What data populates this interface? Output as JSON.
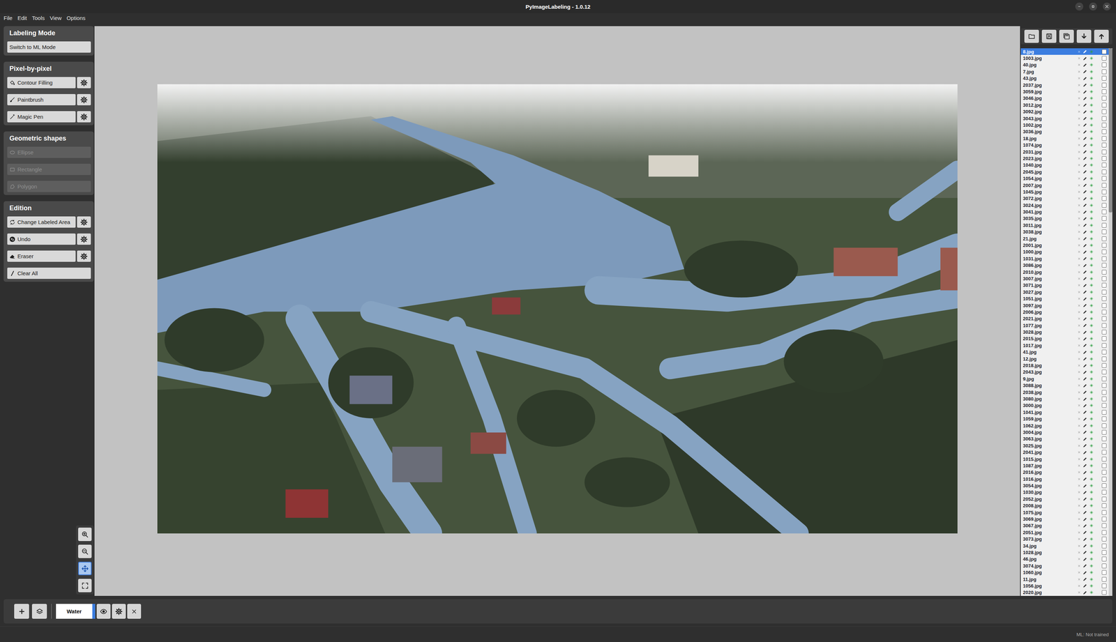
{
  "window": {
    "title": "PyImageLabeling - 1.0.12"
  },
  "menu": [
    "File",
    "Edit",
    "Tools",
    "View",
    "Options"
  ],
  "tool_groups": [
    {
      "title": "Labeling Mode",
      "tools": [
        {
          "label": "Switch to ML Mode",
          "disabled": false,
          "settings": false
        }
      ]
    },
    {
      "title": "Pixel-by-pixel",
      "tools": [
        {
          "label": "Contour Filling",
          "disabled": false,
          "settings": true
        },
        {
          "label": "Paintbrush",
          "disabled": false,
          "settings": true
        },
        {
          "label": "Magic Pen",
          "disabled": false,
          "settings": true
        }
      ]
    },
    {
      "title": "Geometric shapes",
      "tools": [
        {
          "label": "Ellipse",
          "disabled": true,
          "settings": false
        },
        {
          "label": "Rectangle",
          "disabled": true,
          "settings": false
        },
        {
          "label": "Polygon",
          "disabled": true,
          "settings": false
        }
      ]
    },
    {
      "title": "Edition",
      "tools": [
        {
          "label": "Change Labeled Area",
          "disabled": false,
          "settings": true
        },
        {
          "label": "Undo",
          "disabled": false,
          "settings": true
        },
        {
          "label": "Eraser",
          "disabled": false,
          "settings": true
        },
        {
          "label": "Clear All",
          "disabled": false,
          "settings": false
        }
      ]
    }
  ],
  "view_tools": [
    {
      "selected": false
    },
    {
      "selected": false
    },
    {
      "selected": true
    },
    {
      "selected": false
    }
  ],
  "file_list": {
    "scroll": {
      "level": 0.3
    },
    "files": [
      {
        "name": "8.jpg",
        "selected": true,
        "checked": false
      },
      {
        "name": "1003.jpg",
        "selected": false,
        "checked": false
      },
      {
        "name": "40.jpg",
        "selected": false,
        "checked": false
      },
      {
        "name": "7.jpg",
        "selected": false,
        "checked": false
      },
      {
        "name": "43.jpg",
        "selected": false,
        "checked": false
      },
      {
        "name": "2037.jpg",
        "selected": false,
        "checked": false
      },
      {
        "name": "3059.jpg",
        "selected": false,
        "checked": false
      },
      {
        "name": "3046.jpg",
        "selected": false,
        "checked": false
      },
      {
        "name": "3012.jpg",
        "selected": false,
        "checked": false
      },
      {
        "name": "3092.jpg",
        "selected": false,
        "checked": false
      },
      {
        "name": "3043.jpg",
        "selected": false,
        "checked": false
      },
      {
        "name": "1002.jpg",
        "selected": false,
        "checked": false
      },
      {
        "name": "3036.jpg",
        "selected": false,
        "checked": false
      },
      {
        "name": "18.jpg",
        "selected": false,
        "checked": false
      },
      {
        "name": "1074.jpg",
        "selected": false,
        "checked": false
      },
      {
        "name": "2031.jpg",
        "selected": false,
        "checked": false
      },
      {
        "name": "2023.jpg",
        "selected": false,
        "checked": false
      },
      {
        "name": "1040.jpg",
        "selected": false,
        "checked": false
      },
      {
        "name": "2045.jpg",
        "selected": false,
        "checked": false
      },
      {
        "name": "1054.jpg",
        "selected": false,
        "checked": false
      },
      {
        "name": "2007.jpg",
        "selected": false,
        "checked": false
      },
      {
        "name": "1045.jpg",
        "selected": false,
        "checked": false
      },
      {
        "name": "3072.jpg",
        "selected": false,
        "checked": false
      },
      {
        "name": "3024.jpg",
        "selected": false,
        "checked": false
      },
      {
        "name": "3041.jpg",
        "selected": false,
        "checked": false
      },
      {
        "name": "3035.jpg",
        "selected": false,
        "checked": false
      },
      {
        "name": "3011.jpg",
        "selected": false,
        "checked": false
      },
      {
        "name": "3038.jpg",
        "selected": false,
        "checked": false
      },
      {
        "name": "21.jpg",
        "selected": false,
        "checked": false
      },
      {
        "name": "2001.jpg",
        "selected": false,
        "checked": false
      },
      {
        "name": "1000.jpg",
        "selected": false,
        "checked": false
      },
      {
        "name": "1031.jpg",
        "selected": false,
        "checked": false
      },
      {
        "name": "3086.jpg",
        "selected": false,
        "checked": false
      },
      {
        "name": "2010.jpg",
        "selected": false,
        "checked": false
      },
      {
        "name": "3007.jpg",
        "selected": false,
        "checked": false
      },
      {
        "name": "3071.jpg",
        "selected": false,
        "checked": false
      },
      {
        "name": "3027.jpg",
        "selected": false,
        "checked": false
      },
      {
        "name": "1051.jpg",
        "selected": false,
        "checked": false
      },
      {
        "name": "3097.jpg",
        "selected": false,
        "checked": false
      },
      {
        "name": "2006.jpg",
        "selected": false,
        "checked": false
      },
      {
        "name": "2021.jpg",
        "selected": false,
        "checked": false
      },
      {
        "name": "1077.jpg",
        "selected": false,
        "checked": false
      },
      {
        "name": "3028.jpg",
        "selected": false,
        "checked": false
      },
      {
        "name": "2015.jpg",
        "selected": false,
        "checked": false
      },
      {
        "name": "1017.jpg",
        "selected": false,
        "checked": false
      },
      {
        "name": "41.jpg",
        "selected": false,
        "checked": false
      },
      {
        "name": "12.jpg",
        "selected": false,
        "checked": false
      },
      {
        "name": "2018.jpg",
        "selected": false,
        "checked": false
      },
      {
        "name": "2043.jpg",
        "selected": false,
        "checked": false
      },
      {
        "name": "9.jpg",
        "selected": false,
        "checked": false
      },
      {
        "name": "3088.jpg",
        "selected": false,
        "checked": false
      },
      {
        "name": "2038.jpg",
        "selected": false,
        "checked": false
      },
      {
        "name": "3080.jpg",
        "selected": false,
        "checked": false
      },
      {
        "name": "3000.jpg",
        "selected": false,
        "checked": false
      },
      {
        "name": "1041.jpg",
        "selected": false,
        "checked": false
      },
      {
        "name": "1059.jpg",
        "selected": false,
        "checked": false
      },
      {
        "name": "1062.jpg",
        "selected": false,
        "checked": false
      },
      {
        "name": "3004.jpg",
        "selected": false,
        "checked": false
      },
      {
        "name": "3063.jpg",
        "selected": false,
        "checked": false
      },
      {
        "name": "3025.jpg",
        "selected": false,
        "checked": false
      },
      {
        "name": "2041.jpg",
        "selected": false,
        "checked": false
      },
      {
        "name": "1015.jpg",
        "selected": false,
        "checked": false
      },
      {
        "name": "1087.jpg",
        "selected": false,
        "checked": false
      },
      {
        "name": "2016.jpg",
        "selected": false,
        "checked": false
      },
      {
        "name": "1016.jpg",
        "selected": false,
        "checked": false
      },
      {
        "name": "3054.jpg",
        "selected": false,
        "checked": false
      },
      {
        "name": "1030.jpg",
        "selected": false,
        "checked": false
      },
      {
        "name": "2052.jpg",
        "selected": false,
        "checked": false
      },
      {
        "name": "2008.jpg",
        "selected": false,
        "checked": false
      },
      {
        "name": "1075.jpg",
        "selected": false,
        "checked": false
      },
      {
        "name": "3069.jpg",
        "selected": false,
        "checked": false
      },
      {
        "name": "3067.jpg",
        "selected": false,
        "checked": false
      },
      {
        "name": "2051.jpg",
        "selected": false,
        "checked": false
      },
      {
        "name": "3073.jpg",
        "selected": false,
        "checked": false
      },
      {
        "name": "34.jpg",
        "selected": false,
        "checked": false
      },
      {
        "name": "1028.jpg",
        "selected": false,
        "checked": false
      },
      {
        "name": "46.jpg",
        "selected": false,
        "checked": false
      },
      {
        "name": "3074.jpg",
        "selected": false,
        "checked": false
      },
      {
        "name": "1060.jpg",
        "selected": false,
        "checked": false
      },
      {
        "name": "11.jpg",
        "selected": false,
        "checked": false
      },
      {
        "name": "1056.jpg",
        "selected": false,
        "checked": false
      },
      {
        "name": "2020.jpg",
        "selected": false,
        "checked": false
      }
    ]
  },
  "layers": [
    {
      "name": "Water",
      "selected": true,
      "visible": true,
      "color": "#3b7de0"
    }
  ],
  "status_bar": {
    "ml": "ML: Not trained"
  }
}
